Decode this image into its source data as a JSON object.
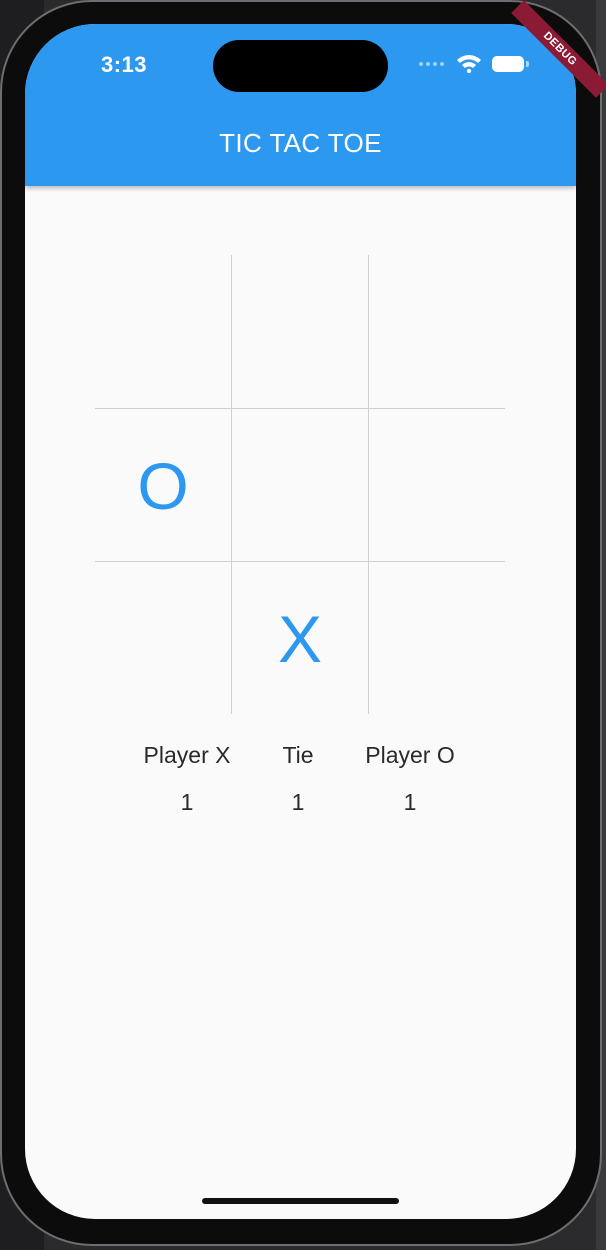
{
  "status_bar": {
    "time": "3:13",
    "debug_banner": "DEBUG"
  },
  "app_bar": {
    "title": "TIC TAC TOE"
  },
  "board": {
    "cells": [
      "",
      "",
      "",
      "O",
      "",
      "",
      "",
      "X",
      ""
    ]
  },
  "scores": {
    "player_x": {
      "label": "Player X",
      "value": "1"
    },
    "tie": {
      "label": "Tie",
      "value": "1"
    },
    "player_o": {
      "label": "Player O",
      "value": "1"
    }
  },
  "colors": {
    "accent": "#2d98ef",
    "debug": "#8b1a35"
  }
}
